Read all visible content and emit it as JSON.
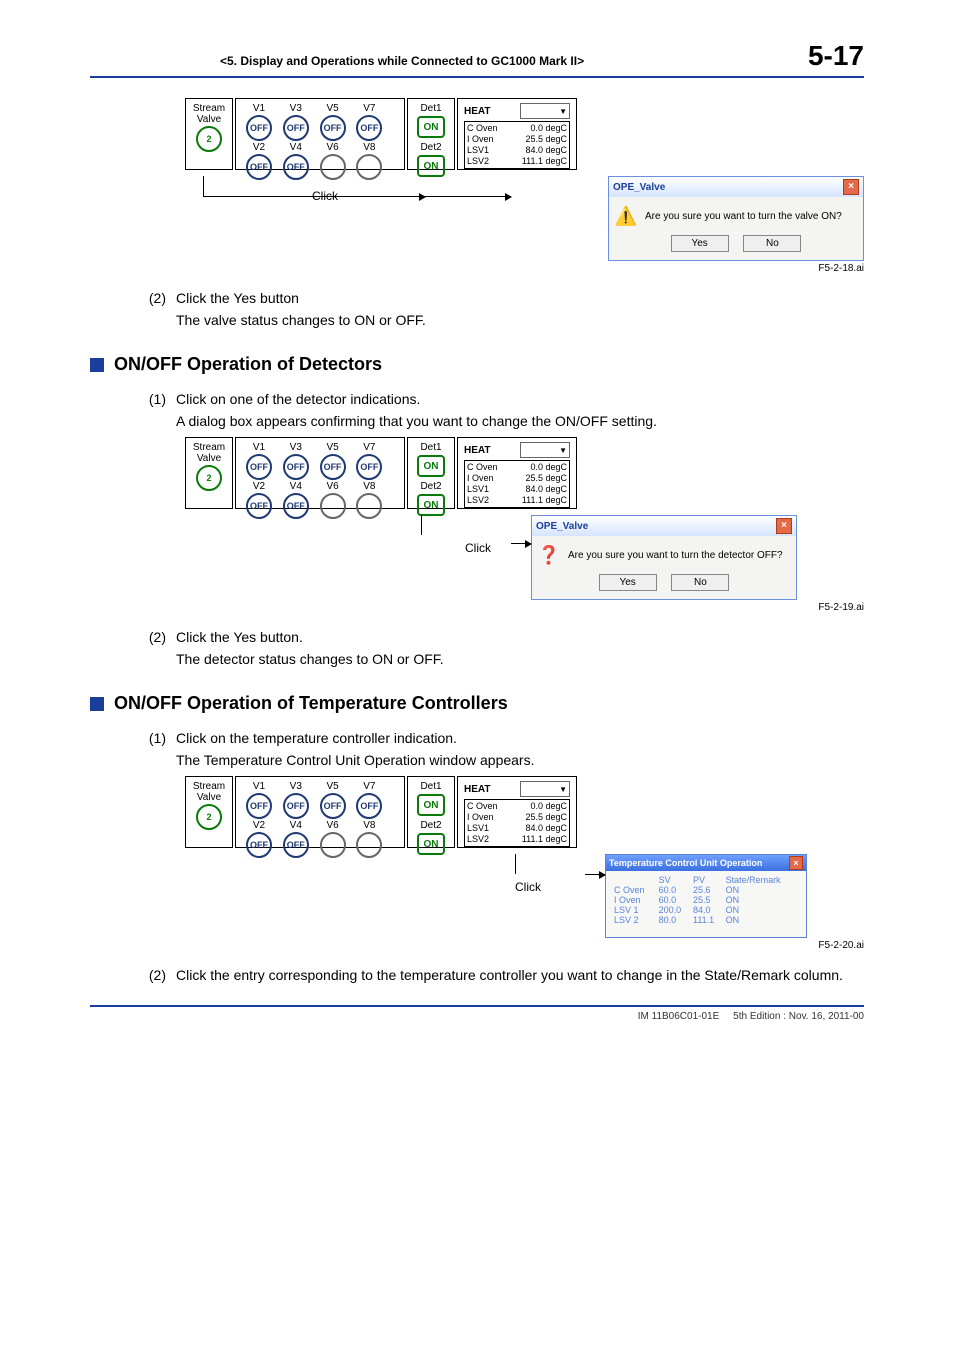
{
  "header": {
    "breadcrumb": "<5.  Display and Operations while Connected to GC1000 Mark II>",
    "page_no": "5-17"
  },
  "panel": {
    "stream_label": "Stream\nValve",
    "stream_value": "2",
    "valves": {
      "row1": [
        {
          "label": "V1",
          "state": "OFF"
        },
        {
          "label": "V3",
          "state": "OFF"
        },
        {
          "label": "V5",
          "state": "OFF"
        },
        {
          "label": "V7",
          "state": "OFF"
        }
      ],
      "row2": [
        {
          "label": "V2",
          "state": "OFF"
        },
        {
          "label": "V4",
          "state": "OFF"
        },
        {
          "label": "V6",
          "state": ""
        },
        {
          "label": "V8",
          "state": ""
        }
      ]
    },
    "det": {
      "d1": {
        "label": "Det1",
        "state": "ON"
      },
      "d2": {
        "label": "Det2",
        "state": "ON"
      }
    },
    "heat": {
      "title": "HEAT",
      "rows": [
        {
          "name": "C Oven",
          "val": "0.0 degC"
        },
        {
          "name": "I  Oven",
          "val": "25.5 degC"
        },
        {
          "name": "LSV1",
          "val": "84.0 degC"
        },
        {
          "name": "LSV2",
          "val": "111.1 degC"
        }
      ]
    }
  },
  "click_label": "Click",
  "dialog_valve": {
    "title": "OPE_Valve",
    "msg": "Are you sure you want to turn the valve ON?",
    "yes": "Yes",
    "no": "No"
  },
  "figrefs": {
    "a": "F5-2-18.ai",
    "b": "F5-2-19.ai",
    "c": "F5-2-20.ai"
  },
  "steps": {
    "s2a_num": "(2)",
    "s2a_txt": "Click the Yes button",
    "s2a_sub": "The valve status changes to ON or OFF.",
    "h_det": "ON/OFF Operation of Detectors",
    "s1b_num": "(1)",
    "s1b_txt": "Click on one of the detector indications.",
    "s1b_sub": "A dialog box appears confirming that you want to change the ON/OFF setting.",
    "s2b_num": "(2)",
    "s2b_txt": "Click the Yes button.",
    "s2b_sub": "The detector status changes to ON or OFF.",
    "h_tcu": "ON/OFF Operation of Temperature Controllers",
    "s1c_num": "(1)",
    "s1c_txt": "Click on the temperature controller indication.",
    "s1c_sub": "The Temperature Control Unit Operation window appears.",
    "s2c_num": "(2)",
    "s2c_txt": "Click the entry corresponding to the temperature controller you want to change in the State/Remark column."
  },
  "dialog_det": {
    "title": "OPE_Valve",
    "msg": "Are you sure you want to turn the detector OFF?",
    "yes": "Yes",
    "no": "No"
  },
  "tcu": {
    "title": "Temperature Control Unit Operation",
    "hdr": {
      "sv": "SV",
      "pv": "PV",
      "sr": "State/Remark"
    },
    "rows": [
      {
        "n": "C Oven",
        "sv": "60.0",
        "pv": "25.6",
        "sr": "ON"
      },
      {
        "n": "I Oven",
        "sv": "60.0",
        "pv": "25.5",
        "sr": "ON"
      },
      {
        "n": "LSV 1",
        "sv": "200.0",
        "pv": "84.0",
        "sr": "ON"
      },
      {
        "n": "LSV 2",
        "sv": "80.0",
        "pv": "111.1",
        "sr": "ON"
      }
    ]
  },
  "footer": {
    "doc": "IM 11B06C01-01E",
    "ed": "5th Edition : Nov. 16, 2011-00"
  }
}
